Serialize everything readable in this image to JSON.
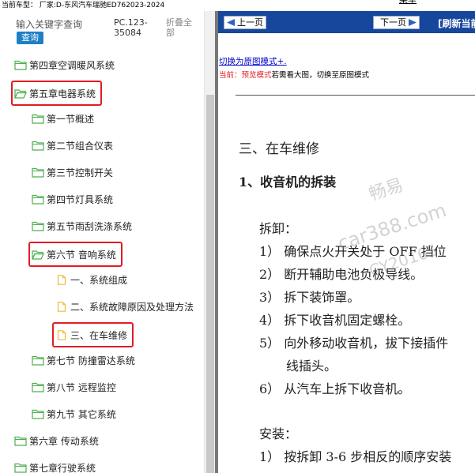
{
  "topbar": {
    "vehicle_info": "当前车型：  厂家:D-东风汽车瑞驰ED762023-2024",
    "right_link": "菜单"
  },
  "search": {
    "placeholder": "输入关键字查询",
    "button_label": "查询",
    "pc_code": "PC.123-35084",
    "collapse_all": "折叠全部"
  },
  "tree": {
    "nodes": [
      {
        "label": "第四章空调暖风系统",
        "type": "folder"
      },
      {
        "label": "第五章电器系统",
        "type": "folder-open",
        "highlighted": true
      },
      {
        "label": "第一节概述",
        "type": "folder"
      },
      {
        "label": "第二节组合仪表",
        "type": "folder"
      },
      {
        "label": "第三节控制开关",
        "type": "folder"
      },
      {
        "label": "第四节灯具系统",
        "type": "folder"
      },
      {
        "label": "第五节雨刮洗涤系统",
        "type": "folder"
      },
      {
        "label": "第六节 音响系统",
        "type": "folder-open",
        "highlighted": true
      },
      {
        "label": "一、系统组成",
        "type": "file"
      },
      {
        "label": "二、系统故障原因及处理方法",
        "type": "file"
      },
      {
        "label": "三、在车维修",
        "type": "file",
        "highlighted": true
      },
      {
        "label": "第七节 防撞雷达系统",
        "type": "folder"
      },
      {
        "label": "第八节 远程监控",
        "type": "folder"
      },
      {
        "label": "第九节 其它系统",
        "type": "folder"
      },
      {
        "label": "第六章 传动系统",
        "type": "folder"
      },
      {
        "label": "第七章行驶系统",
        "type": "folder"
      }
    ]
  },
  "nav": {
    "prev_label": "上一页",
    "next_label": "下一页",
    "refresh_label": "刷新当前"
  },
  "mode": {
    "switch_link": "切换为原图模式+.",
    "current_prefix": "当前：",
    "current_mode": "预览模式",
    "hint_big": "若需看大图",
    "hint_rest": "，切换至原图模式"
  },
  "document": {
    "section_title": "三、在车维修",
    "subsection_title": "1、收音机的拆装",
    "removal_heading": "拆卸：",
    "removal_steps": [
      "1） 确保点火开关处于 OFF 挡位",
      "2） 断开辅助电池负极导线。",
      "3） 拆下装饰罩。",
      "4） 拆下收音机固定螺栓。",
      "5） 向外移动收音机，拔下接插件",
      "线插头。",
      "6） 从汽车上拆下收音机。"
    ],
    "install_heading": "安装：",
    "install_steps": [
      "1） 按拆卸 3-6 步相反的顺序安装"
    ]
  },
  "watermark": {
    "line1": "畅易",
    "line2": "car388.com",
    "line3": "CY20165"
  },
  "colors": {
    "highlight": "#e21c24",
    "nav_bar": "#17479c",
    "search_button": "#1f7fc6",
    "folder_icon": "#4caf50",
    "file_icon": "#f0b93a"
  }
}
